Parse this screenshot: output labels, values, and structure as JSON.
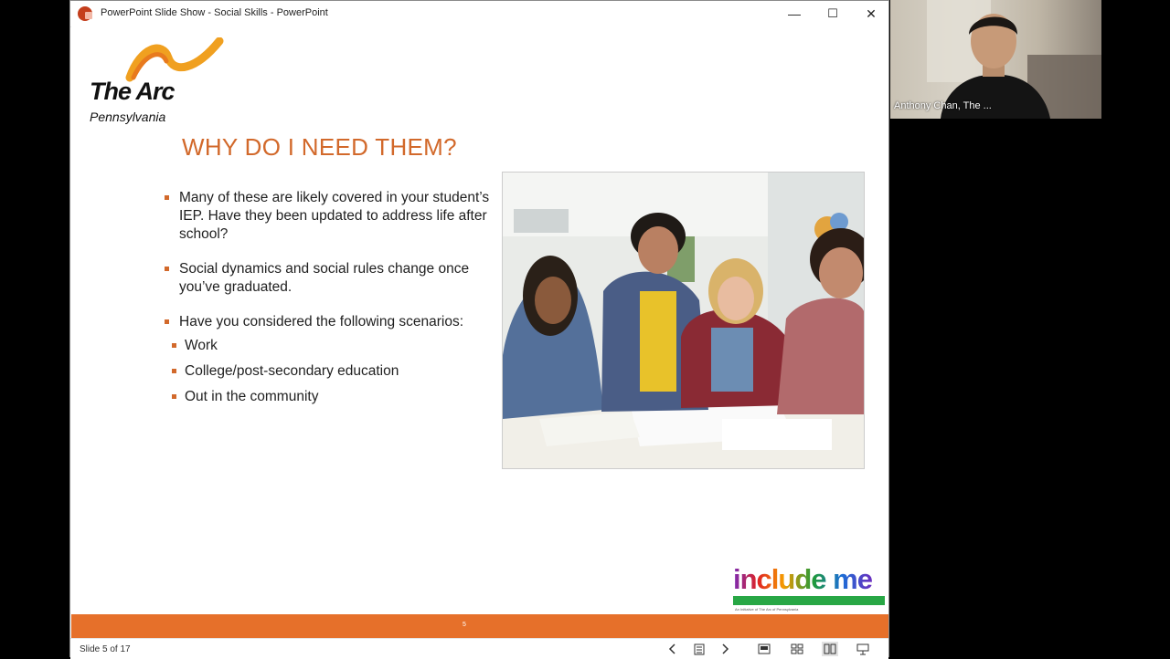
{
  "window": {
    "title": "PowerPoint Slide Show  -  Social Skills - PowerPoint",
    "controls": {
      "minimize": "—",
      "maximize": "☐",
      "close": "✕"
    }
  },
  "slide": {
    "logo": {
      "name": "The Arc",
      "sub": "Pennsylvania"
    },
    "heading": "WHY DO I NEED THEM?",
    "bullets": [
      "Many of these are likely covered in your student’s IEP. Have they been updated to address life after school?",
      "Social dynamics and social rules change once you’ve graduated.",
      "Have you considered the following scenarios:"
    ],
    "subbullets": [
      "Work",
      "College/post-secondary education",
      "Out in the community"
    ],
    "include_logo": {
      "text": "include me",
      "tagline": "An Initiative of The Arc of Pennsylvania"
    },
    "footer_number": "5",
    "colors": {
      "accent": "#d2692b",
      "footer_bar": "#e6702a"
    }
  },
  "status": {
    "slide_position": "Slide 5 of 17"
  },
  "status_icons": [
    "prev-slide-icon",
    "slide-sorter-icon",
    "next-slide-icon",
    "normal-view-icon",
    "grid-view-icon",
    "reading-view-icon",
    "presenter-view-icon"
  ],
  "video": {
    "participant_name": "Anthony Chan, The ..."
  }
}
